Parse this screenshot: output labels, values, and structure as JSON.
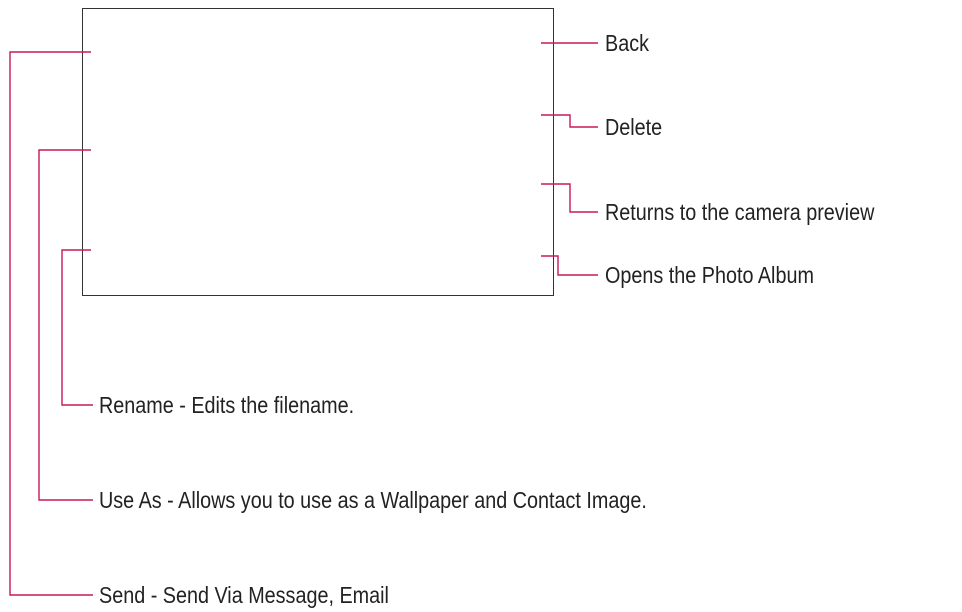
{
  "callouts": {
    "back": "Back",
    "delete": "Delete",
    "camera_preview": "Returns to the camera preview",
    "photo_album": "Opens the Photo Album",
    "rename": "Rename - Edits the filename.",
    "use_as": "Use As - Allows you to use as a Wallpaper and Contact Image.",
    "send": "Send - Send Via Message, Email"
  },
  "colors": {
    "callout_line": "#c8185a",
    "frame": "#333333",
    "text": "#222222"
  }
}
